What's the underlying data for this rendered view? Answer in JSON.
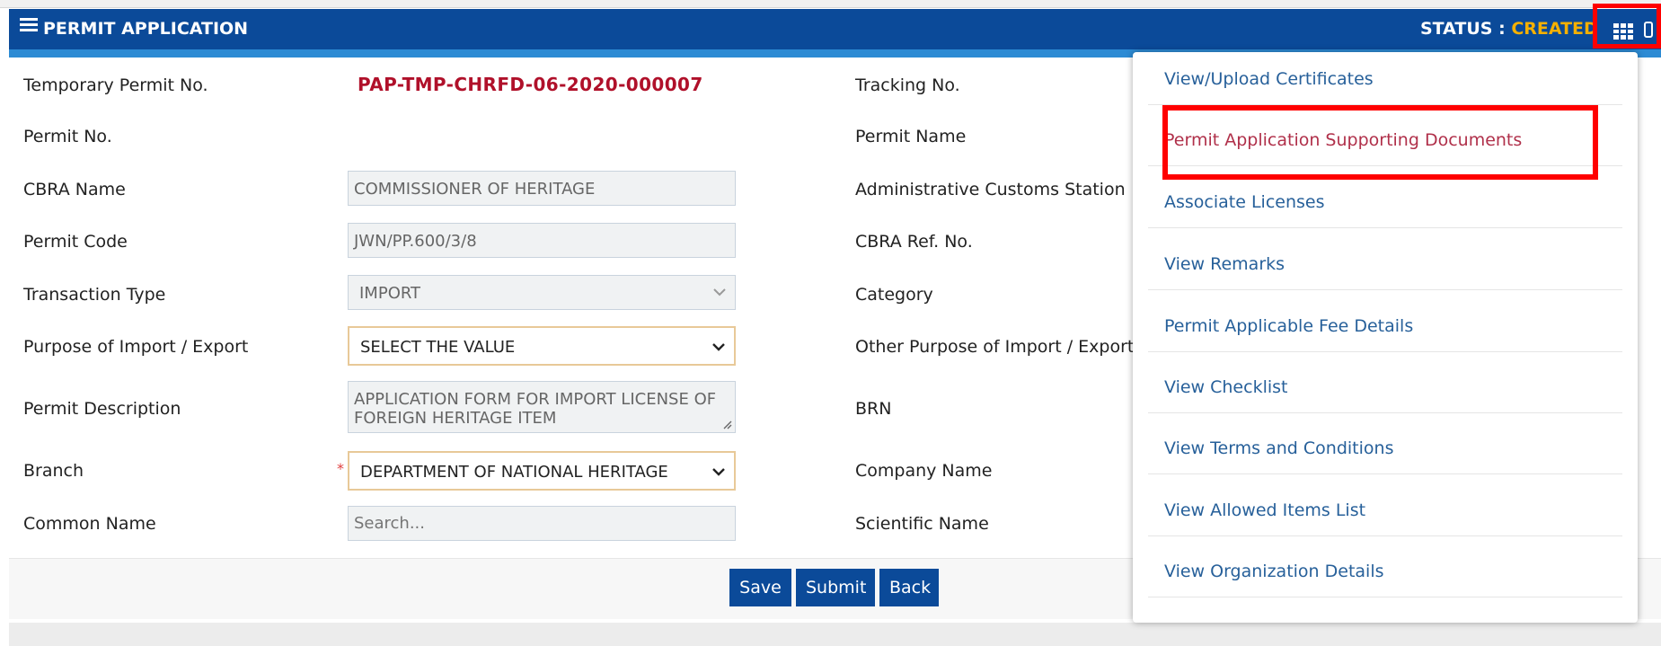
{
  "header": {
    "title": "PERMIT APPLICATION",
    "status_label": "STATUS : ",
    "status_value": "CREATED"
  },
  "form": {
    "left": [
      {
        "label": "Temporary Permit No.",
        "value": "PAP-TMP-CHRFD-06-2020-000007"
      },
      {
        "label": "Permit No.",
        "value": ""
      },
      {
        "label": "CBRA Name",
        "value": "COMMISSIONER OF HERITAGE"
      },
      {
        "label": "Permit Code",
        "value": "JWN/PP.600/3/8"
      },
      {
        "label": "Transaction Type",
        "value": "IMPORT"
      },
      {
        "label": "Purpose of Import / Export",
        "value": "SELECT THE VALUE"
      },
      {
        "label": "Permit Description",
        "value": "APPLICATION FORM FOR IMPORT LICENSE OF FOREIGN HERITAGE ITEM"
      },
      {
        "label": "Branch",
        "value": "DEPARTMENT OF NATIONAL HERITAGE"
      },
      {
        "label": "Common Name",
        "placeholder": "Search..."
      }
    ],
    "right": [
      {
        "label": "Tracking No."
      },
      {
        "label": "Permit Name"
      },
      {
        "label": "Administrative Customs Station"
      },
      {
        "label": "CBRA Ref. No."
      },
      {
        "label": "Category"
      },
      {
        "label": "Other Purpose of Import / Export"
      },
      {
        "label": "BRN"
      },
      {
        "label": "Company Name"
      },
      {
        "label": "Scientific Name"
      }
    ],
    "required_mark": "*"
  },
  "buttons": {
    "save": "Save",
    "submit": "Submit",
    "back": "Back"
  },
  "menu": {
    "items": [
      "View/Upload Certificates",
      "Permit Application Supporting Documents",
      "Associate Licenses",
      "View Remarks",
      "Permit Applicable Fee Details",
      "View Checklist",
      "View Terms and Conditions",
      "View Allowed Items List",
      "View Organization Details"
    ]
  },
  "icons": {
    "menu": "menu-icon",
    "grid": "grid-icon",
    "chevron": "chevron-down-icon",
    "resize": "resize-handle-icon"
  },
  "colors": {
    "header": "#0b4a99",
    "status_value": "#f5b000",
    "permit_no": "#b0102a",
    "link": "#27609a",
    "highlight_link": "#b0304a",
    "annotation": "#ff0000"
  }
}
